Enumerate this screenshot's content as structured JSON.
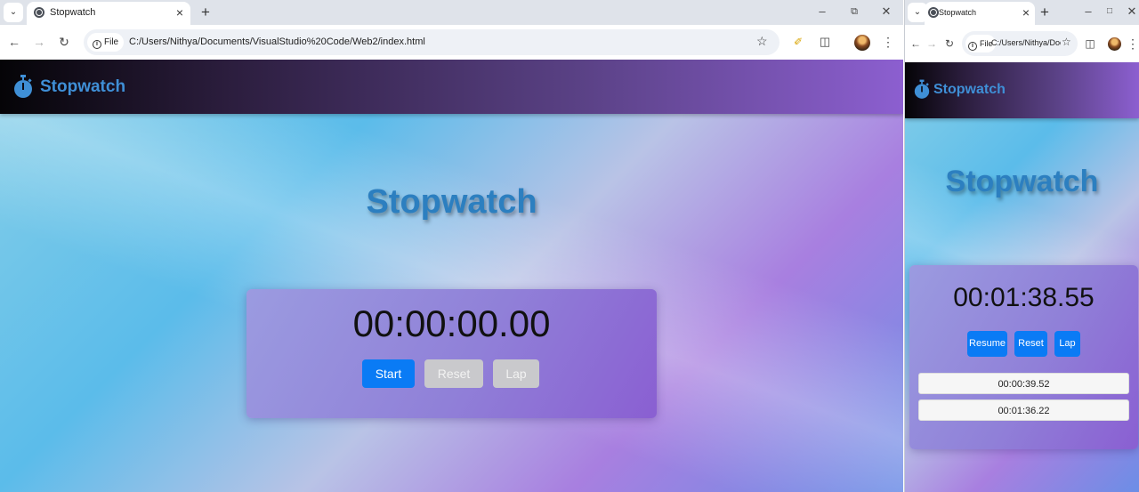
{
  "left": {
    "tab": {
      "title": "Stopwatch"
    },
    "url": {
      "scheme_label": "File",
      "address": "C:/Users/Nithya/Documents/VisualStudio%20Code/Web2/index.html"
    },
    "navbar": {
      "brand": "Stopwatch"
    },
    "heading": "Stopwatch",
    "timer": "00:00:00.00",
    "buttons": {
      "start": "Start",
      "reset": "Reset",
      "lap": "Lap"
    }
  },
  "right": {
    "tab": {
      "title": "Stopwatch"
    },
    "url": {
      "scheme_label": "File",
      "address": "C:/Users/Nithya/Doc..."
    },
    "navbar": {
      "brand": "Stopwatch"
    },
    "heading": "Stopwatch",
    "timer": "00:01:38.55",
    "buttons": {
      "resume": "Resume",
      "reset": "Reset",
      "lap": "Lap"
    },
    "laps": [
      "00:00:39.52",
      "00:01:36.22"
    ]
  },
  "colors": {
    "primary_button": "#0a7bf5",
    "disabled_button": "#c9c9cc",
    "heading": "#2c7fc0",
    "navbar_start": "#050407",
    "navbar_end": "#8c5fd0"
  }
}
